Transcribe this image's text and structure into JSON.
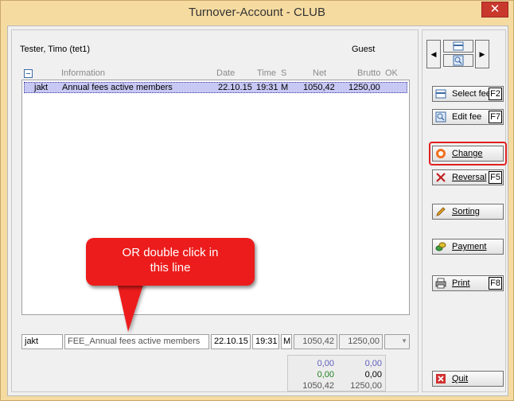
{
  "window": {
    "title": "Turnover-Account - CLUB",
    "close_label": "✕"
  },
  "member": {
    "name": "Tester, Timo (tet1)",
    "type": "Guest"
  },
  "list": {
    "columns": {
      "information": "Information",
      "date": "Date",
      "time": "Time",
      "s": "S",
      "net": "Net",
      "brutto": "Brutto",
      "ok": "OK"
    },
    "rows": [
      {
        "code": "jakt",
        "information": "Annual fees active members",
        "date": "22.10.15",
        "time": "19:31",
        "s": "M",
        "net": "1050,42",
        "brutto": "1250,00"
      }
    ]
  },
  "detail": {
    "code": "jakt",
    "information": "FEE_Annual fees active members",
    "date": "22.10.15",
    "time": "19:31",
    "s": "M",
    "net": "1050,42",
    "brutto": "1250,00"
  },
  "totals": {
    "row1_net": "0,00",
    "row1_brutto": "0,00",
    "row2_net": "0,00",
    "row2_brutto": "0,00",
    "row3_net": "1050,42",
    "row3_brutto": "1250,00"
  },
  "callout": {
    "line1": "OR double click in",
    "line2": "this line"
  },
  "actions": {
    "select_fee": {
      "label": "Select fee",
      "key": "F2"
    },
    "edit_fee": {
      "label": "Edit fee",
      "key": "F7"
    },
    "change": {
      "label": "Change"
    },
    "reversal": {
      "label": "Reversal",
      "key": "F5"
    },
    "sorting": {
      "label": "Sorting"
    },
    "payment": {
      "label": "Payment"
    },
    "print": {
      "label": "Print",
      "key": "F8"
    },
    "quit": {
      "label": "Quit"
    }
  },
  "colors": {
    "callout": "#ed1c1c",
    "selected_row": "#c8c8f4",
    "totals_blue": "#6060c0",
    "totals_green": "#208020",
    "highlight": "#e02020"
  },
  "icons": {
    "nav_left": "arrow-left-icon",
    "nav_right": "arrow-right-icon",
    "select_fee": "list-select-icon",
    "edit_fee": "magnifier-icon",
    "change": "lifebuoy-icon",
    "reversal": "x-cross-icon",
    "sorting": "pencil-icon",
    "payment": "coins-icon",
    "print": "printer-icon",
    "quit": "quit-x-icon"
  }
}
